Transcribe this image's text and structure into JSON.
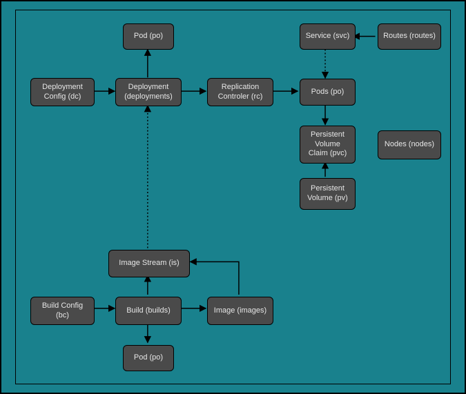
{
  "chart_data": {
    "type": "diagram",
    "nodes": [
      {
        "id": "dc",
        "label": "Deployment\nConfig (dc)"
      },
      {
        "id": "dep",
        "label": "Deployment\n(deployments)"
      },
      {
        "id": "pod_top",
        "label": "Pod (po)"
      },
      {
        "id": "rc",
        "label": "Replication\nControler (rc)"
      },
      {
        "id": "svc",
        "label": "Service (svc)"
      },
      {
        "id": "routes",
        "label": "Routes (routes)"
      },
      {
        "id": "pods",
        "label": "Pods (po)"
      },
      {
        "id": "pvc",
        "label": "Persistent\nVolume\nClaim (pvc)"
      },
      {
        "id": "nodes",
        "label": "Nodes (nodes)"
      },
      {
        "id": "pv",
        "label": "Persistent\nVolume (pv)"
      },
      {
        "id": "is",
        "label": "Image Stream (is)"
      },
      {
        "id": "bc",
        "label": "Build\nConfig (bc)"
      },
      {
        "id": "build",
        "label": "Build (builds)"
      },
      {
        "id": "image",
        "label": "Image (images)"
      },
      {
        "id": "pod_bot",
        "label": "Pod (po)"
      }
    ],
    "edges": [
      {
        "from": "dc",
        "to": "dep",
        "style": "solid"
      },
      {
        "from": "dep",
        "to": "pod_top",
        "style": "solid"
      },
      {
        "from": "dep",
        "to": "rc",
        "style": "solid"
      },
      {
        "from": "rc",
        "to": "pods",
        "style": "solid"
      },
      {
        "from": "routes",
        "to": "svc",
        "style": "solid"
      },
      {
        "from": "svc",
        "to": "pods",
        "style": "dotted"
      },
      {
        "from": "pods",
        "to": "pvc",
        "style": "solid"
      },
      {
        "from": "pv",
        "to": "pvc",
        "style": "solid"
      },
      {
        "from": "is",
        "to": "dep",
        "style": "dotted"
      },
      {
        "from": "bc",
        "to": "build",
        "style": "solid"
      },
      {
        "from": "build",
        "to": "is",
        "style": "solid"
      },
      {
        "from": "build",
        "to": "image",
        "style": "solid"
      },
      {
        "from": "image",
        "to": "is",
        "style": "solid"
      },
      {
        "from": "build",
        "to": "pod_bot",
        "style": "solid"
      }
    ]
  },
  "labels": {
    "dc": "Deployment Config (dc)",
    "dep": "Deployment (deployments)",
    "pod_top": "Pod (po)",
    "rc": "Replication Controler (rc)",
    "svc": "Service (svc)",
    "routes": "Routes (routes)",
    "pods": "Pods (po)",
    "pvc": "Persistent Volume Claim (pvc)",
    "nodes": "Nodes (nodes)",
    "pv": "Persistent Volume (pv)",
    "is": "Image Stream (is)",
    "bc": "Build Config (bc)",
    "build": "Build (builds)",
    "image": "Image (images)",
    "pod_bot": "Pod (po)"
  }
}
